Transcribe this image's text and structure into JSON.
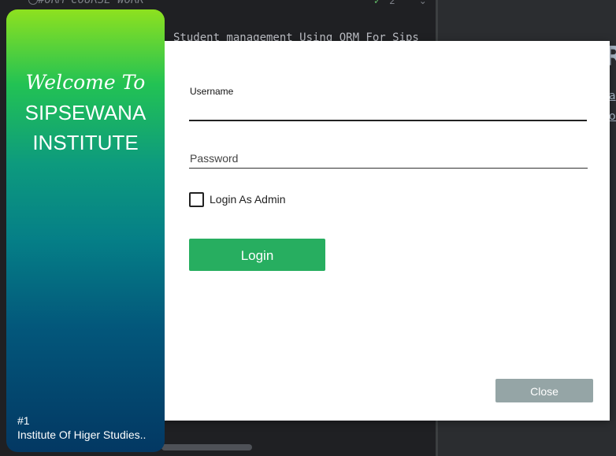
{
  "ide": {
    "comment_line": "#ORM COURSE WORK",
    "code_line": "Student management Using ORM For Sips",
    "inspection_count": "2",
    "right_panel_heading": "R",
    "right_panel_link_1": "a",
    "right_panel_link_2": "ol"
  },
  "side_panel": {
    "welcome": "Welcome To",
    "institute_line1": "SIPSEWANA",
    "institute_line2": "INSTITUTE",
    "rank": "#1",
    "tagline": "Institute Of Higer Studies.."
  },
  "form": {
    "username_label": "Username",
    "username_value": "",
    "password_placeholder": "Password",
    "admin_checkbox_label": "Login As Admin",
    "admin_checked": false,
    "login_button": "Login",
    "close_button": "Close"
  },
  "colors": {
    "login_button": "#27ae60",
    "close_button": "#95a5a6",
    "gradient_top": "#8ee11f",
    "gradient_bottom": "#033863"
  }
}
